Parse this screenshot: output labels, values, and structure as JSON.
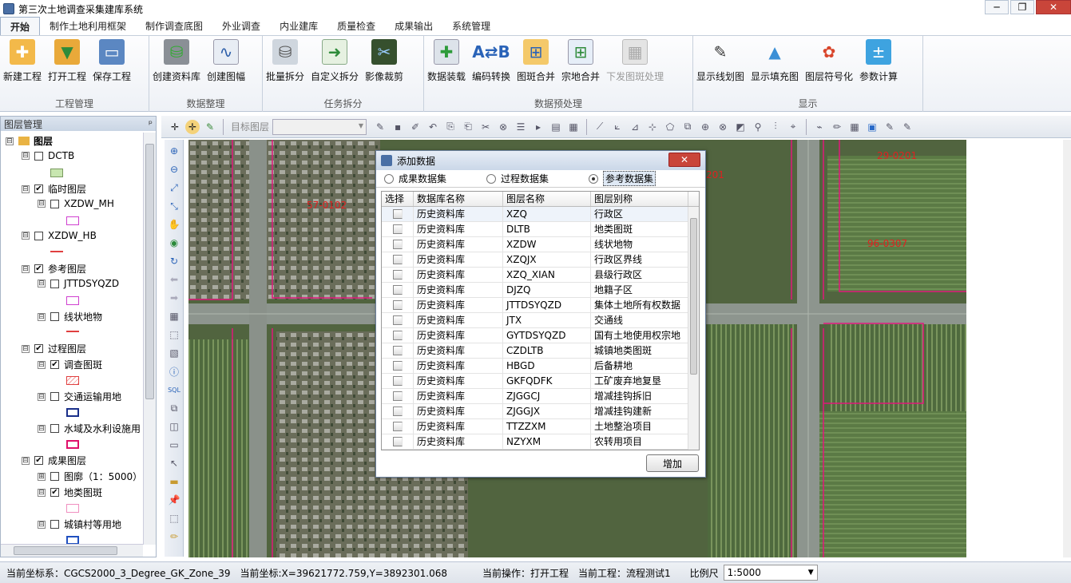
{
  "window": {
    "title": "第三次土地调查采集建库系统",
    "minimize": "─",
    "restore": "❐",
    "close": "✕"
  },
  "menu": [
    {
      "label": "开始",
      "active": true
    },
    {
      "label": "制作土地利用框架"
    },
    {
      "label": "制作调查底图"
    },
    {
      "label": "外业调查"
    },
    {
      "label": "内业建库"
    },
    {
      "label": "质量检查"
    },
    {
      "label": "成果输出"
    },
    {
      "label": "系统管理"
    }
  ],
  "ribbon": {
    "groups": [
      {
        "name": "工程管理",
        "buttons": [
          "新建工程",
          "打开工程",
          "保存工程"
        ]
      },
      {
        "name": "数据整理",
        "buttons": [
          "创建资料库",
          "创建图幅"
        ]
      },
      {
        "name": "任务拆分",
        "buttons": [
          "批量拆分",
          "自定义拆分",
          "影像裁剪"
        ]
      },
      {
        "name": "数据预处理",
        "buttons": [
          "数据装载",
          "编码转换",
          "图斑合并",
          "宗地合并",
          "下发图斑处理"
        ]
      },
      {
        "name": "显示",
        "buttons": [
          "显示线划图",
          "显示填充图",
          "图层符号化",
          "参数计算"
        ]
      }
    ]
  },
  "layer_panel": {
    "title": "图层管理",
    "pin": "ᵖ",
    "nodes": [
      {
        "label": "图层",
        "expand": "⊟"
      },
      {
        "label": "DCTB",
        "expand": "⊟",
        "checked": false
      },
      {
        "label": "临时图层",
        "expand": "⊟",
        "checked": true
      },
      {
        "label": "XZDW_MH",
        "expand": "⊟",
        "checked": false
      },
      {
        "label": "XZDW_HB",
        "expand": "⊟",
        "checked": false
      },
      {
        "label": "参考图层",
        "expand": "⊟",
        "checked": true
      },
      {
        "label": "JTTDSYQZD",
        "expand": "⊟",
        "checked": false
      },
      {
        "label": "线状地物",
        "expand": "⊟",
        "checked": false
      },
      {
        "label": "过程图层",
        "expand": "⊟",
        "checked": true
      },
      {
        "label": "调查图斑",
        "expand": "⊟",
        "checked": true
      },
      {
        "label": "交通运输用地",
        "expand": "⊟",
        "checked": false
      },
      {
        "label": "水域及水利设施用",
        "expand": "⊟",
        "checked": false
      },
      {
        "label": "成果图层",
        "expand": "⊟",
        "checked": true
      },
      {
        "label": "图廓（1：5000）",
        "expand": "⊞",
        "checked": false
      },
      {
        "label": "地类图斑",
        "expand": "⊟",
        "checked": true
      },
      {
        "label": "城镇村等用地",
        "expand": "⊟",
        "checked": false
      }
    ]
  },
  "toolbar": {
    "target_layer_label": "目标图层"
  },
  "map": {
    "labels": [
      "57-0102",
      "29-0201",
      "201",
      "96-0307"
    ],
    "label_color": "#e02020"
  },
  "dialog": {
    "title": "添加数据",
    "close": "✕",
    "radios": [
      {
        "label": "成果数据集",
        "selected": false
      },
      {
        "label": "过程数据集",
        "selected": false
      },
      {
        "label": "参考数据集",
        "selected": true
      }
    ],
    "columns": [
      "选择",
      "数据库名称",
      "图层名称",
      "图层别称"
    ],
    "rows": [
      [
        "历史资料库",
        "XZQ",
        "行政区"
      ],
      [
        "历史资料库",
        "DLTB",
        "地类图斑"
      ],
      [
        "历史资料库",
        "XZDW",
        "线状地物"
      ],
      [
        "历史资料库",
        "XZQJX",
        "行政区界线"
      ],
      [
        "历史资料库",
        "XZQ_XIAN",
        "县级行政区"
      ],
      [
        "历史资料库",
        "DJZQ",
        "地籍子区"
      ],
      [
        "历史资料库",
        "JTTDSYQZD",
        "集体土地所有权数据"
      ],
      [
        "历史资料库",
        "JTX",
        "交通线"
      ],
      [
        "历史资料库",
        "GYTDSYQZD",
        "国有土地使用权宗地"
      ],
      [
        "历史资料库",
        "CZDLTB",
        "城镇地类图斑"
      ],
      [
        "历史资料库",
        "HBGD",
        "后备耕地"
      ],
      [
        "历史资料库",
        "GKFQDFK",
        "工矿废弃地复垦"
      ],
      [
        "历史资料库",
        "ZJGGCJ",
        "增减挂钩拆旧"
      ],
      [
        "历史资料库",
        "ZJGGJX",
        "增减挂钩建新"
      ],
      [
        "历史资料库",
        "TTZZXM",
        "土地整治项目"
      ],
      [
        "历史资料库",
        "NZYXM",
        "农转用项目"
      ]
    ],
    "add_button": "增加"
  },
  "status": {
    "crs": "当前坐标系：CGCS2000_3_Degree_GK_Zone_39",
    "coords": "当前坐标:X=39621772.759,Y=3892301.068",
    "operation": "当前操作：打开工程",
    "project": "当前工程：流程测试1",
    "scale_label": "比例尺",
    "scale_value": "1:5000"
  }
}
